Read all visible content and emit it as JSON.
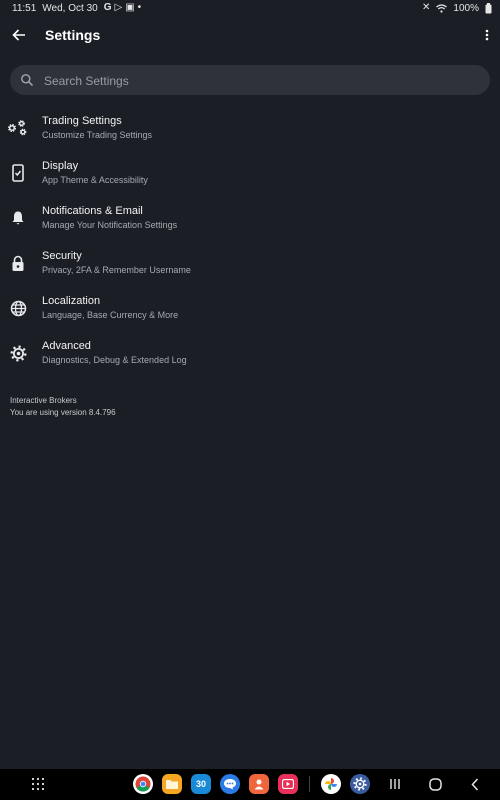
{
  "status_bar": {
    "time": "11:51",
    "date": "Wed, Oct 30",
    "battery": "100%"
  },
  "app_bar": {
    "title": "Settings"
  },
  "search": {
    "placeholder": "Search Settings"
  },
  "settings_items": [
    {
      "title": "Trading Settings",
      "subtitle": "Customize Trading Settings",
      "icon": "trading-settings-icon"
    },
    {
      "title": "Display",
      "subtitle": "App Theme & Accessibility",
      "icon": "display-icon"
    },
    {
      "title": "Notifications & Email",
      "subtitle": "Manage Your Notification Settings",
      "icon": "bell-icon"
    },
    {
      "title": "Security",
      "subtitle": "Privacy, 2FA & Remember Username",
      "icon": "lock-icon"
    },
    {
      "title": "Localization",
      "subtitle": "Language, Base Currency & More",
      "icon": "globe-icon"
    },
    {
      "title": "Advanced",
      "subtitle": "Diagnostics, Debug & Extended Log",
      "icon": "gear-icon"
    }
  ],
  "footer": {
    "company": "Interactive Brokers",
    "version_text": "You are using version 8.4.796"
  },
  "dock": {
    "calendar_day": "30"
  },
  "colors": {
    "background": "#1b1e25",
    "search_bg": "#2f323a",
    "nav_bar": "#000000"
  }
}
